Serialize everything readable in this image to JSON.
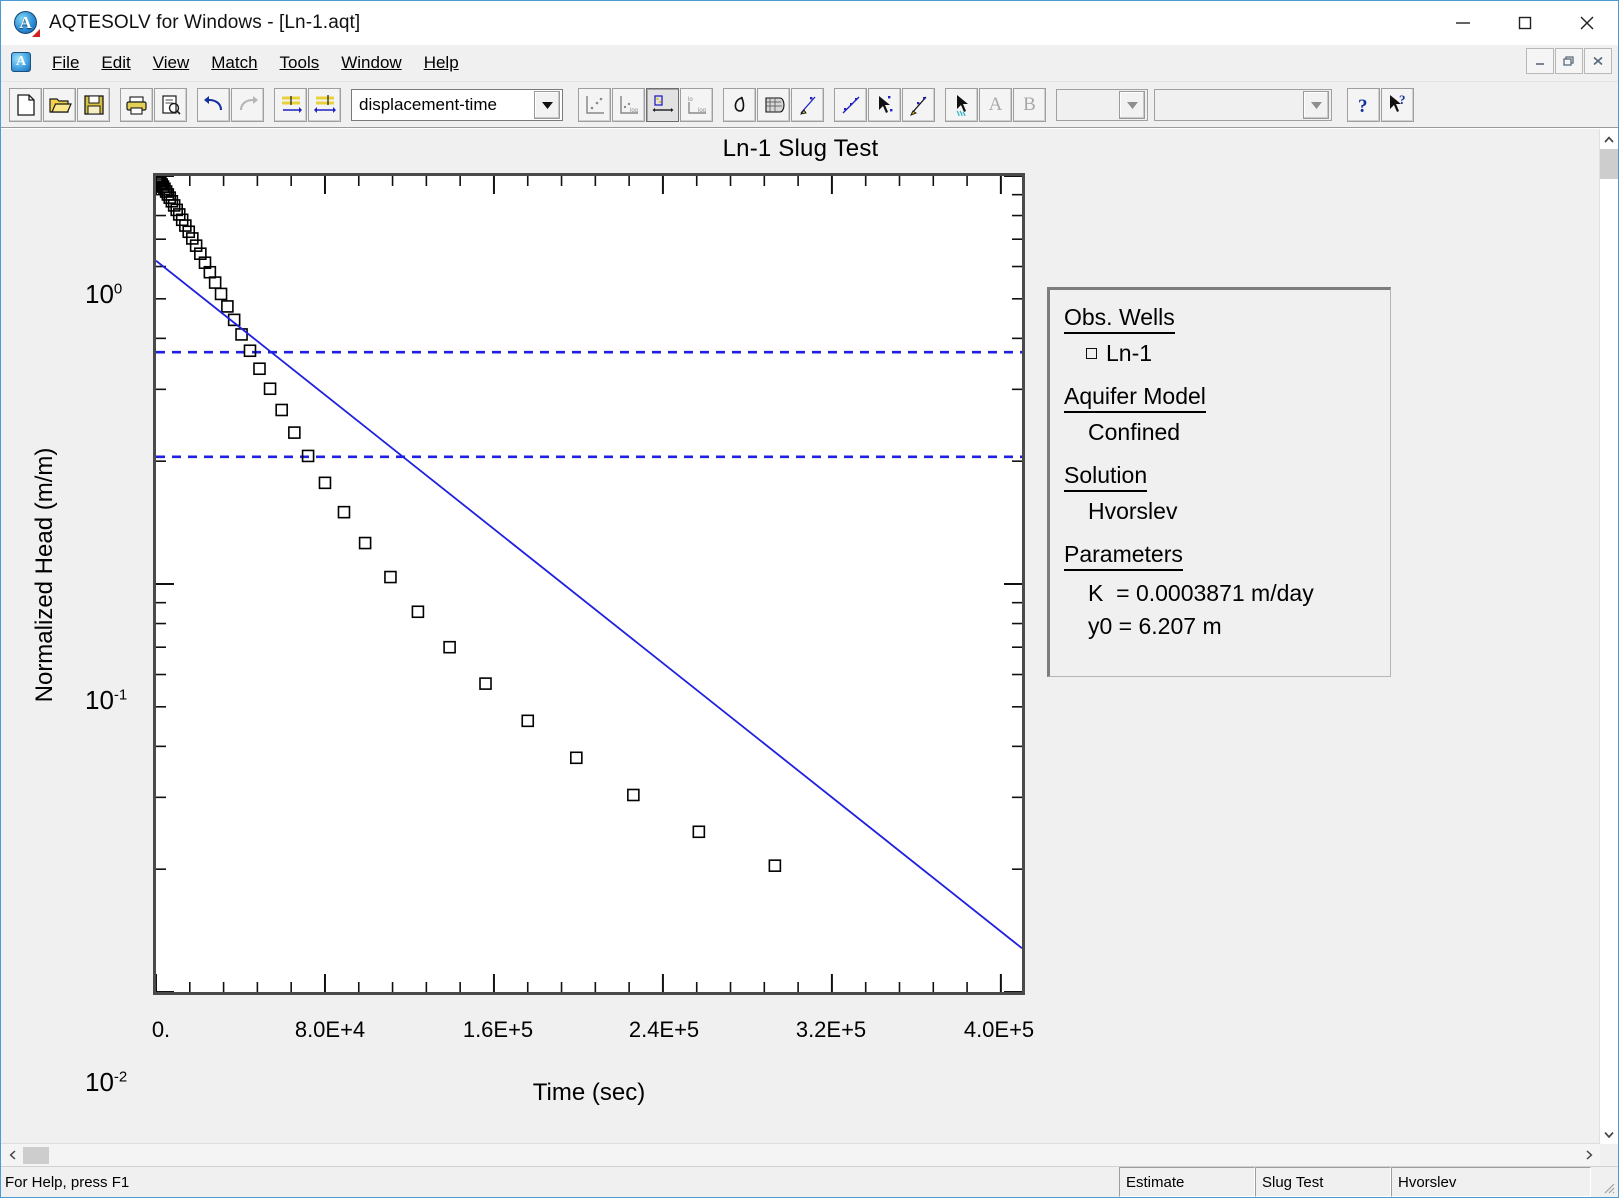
{
  "window": {
    "title": "AQTESOLV for Windows - [Ln-1.aqt]",
    "minimize_label": "Minimize",
    "maximize_label": "Maximize",
    "close_label": "Close"
  },
  "menu": {
    "items": [
      {
        "label": "File",
        "accel": "F"
      },
      {
        "label": "Edit",
        "accel": "E"
      },
      {
        "label": "View",
        "accel": "V"
      },
      {
        "label": "Match",
        "accel": "M"
      },
      {
        "label": "Tools",
        "accel": "T"
      },
      {
        "label": "Window",
        "accel": "W"
      },
      {
        "label": "Help",
        "accel": "H"
      }
    ],
    "mdi_restore_label": "Restore",
    "mdi_minimize_label": "Minimize",
    "mdi_close_label": "Close"
  },
  "toolbar": {
    "plot_type_value": "displacement-time",
    "combo2_value": "",
    "combo3_value": "",
    "buttons": [
      "new-icon",
      "open-icon",
      "save-icon",
      "print-icon",
      "print-preview-icon",
      "undo-icon",
      "redo-icon",
      "well-data-icon",
      "aquifer-data-icon",
      "linear-axes-icon",
      "semilog-axes-icon",
      "log-linear-axes-icon",
      "log-log-axes-icon",
      "derivative-icon",
      "grid-icon",
      "visual-match-icon",
      "auto-fit-icon",
      "select-point-icon",
      "match-line-icon",
      "pointer-icon",
      "text-a-icon",
      "text-b-icon"
    ],
    "letter_a": "A",
    "letter_b": "B",
    "help_label": "?",
    "context_help_label": "?"
  },
  "legend": {
    "sections": [
      {
        "heading": "Obs. Wells",
        "items": [
          {
            "marker": "square-marker",
            "text": "Ln-1"
          }
        ]
      },
      {
        "heading": "Aquifer Model",
        "items": [
          {
            "marker": "",
            "text": "Confined"
          }
        ]
      },
      {
        "heading": "Solution",
        "items": [
          {
            "marker": "",
            "text": "Hvorslev"
          }
        ]
      }
    ],
    "parameters_heading": "Parameters",
    "parameters": [
      "K  = 0.0003871 m/day",
      "y0 = 6.207 m"
    ]
  },
  "status": {
    "help_text": "For Help, press F1",
    "panes": [
      "Estimate",
      "Slug Test",
      "Hvorslev"
    ]
  },
  "chart_data": {
    "type": "scatter",
    "title": "Ln-1 Slug Test",
    "xlabel": "Time (sec)",
    "ylabel": "Normalized Head (m/m)",
    "xscale": "linear",
    "yscale": "log",
    "xlim": [
      0,
      410000
    ],
    "ylim": [
      0.01,
      1.0
    ],
    "grid": false,
    "legend_position": "right-outside",
    "xticks": [
      {
        "value": 0,
        "label": "0."
      },
      {
        "value": 80000,
        "label": "8.0E+4"
      },
      {
        "value": 160000,
        "label": "1.6E+5"
      },
      {
        "value": 240000,
        "label": "2.4E+5"
      },
      {
        "value": 320000,
        "label": "3.2E+5"
      },
      {
        "value": 400000,
        "label": "4.0E+5"
      }
    ],
    "yticks": [
      {
        "value": 1.0,
        "mantissa": "10",
        "exponent": "0"
      },
      {
        "value": 0.1,
        "mantissa": "10",
        "exponent": "-1"
      },
      {
        "value": 0.01,
        "mantissa": "10",
        "exponent": "-2"
      }
    ],
    "series": [
      {
        "name": "Ln-1",
        "type": "scatter",
        "marker": "open-square",
        "color": "#000000",
        "points": [
          [
            300,
            0.995
          ],
          [
            700,
            0.988
          ],
          [
            1100,
            0.98
          ],
          [
            1600,
            0.972
          ],
          [
            2100,
            0.963
          ],
          [
            2700,
            0.953
          ],
          [
            3300,
            0.942
          ],
          [
            4000,
            0.93
          ],
          [
            4800,
            0.916
          ],
          [
            5600,
            0.901
          ],
          [
            6500,
            0.885
          ],
          [
            7500,
            0.867
          ],
          [
            8600,
            0.847
          ],
          [
            9800,
            0.826
          ],
          [
            11000,
            0.805
          ],
          [
            12400,
            0.781
          ],
          [
            13900,
            0.756
          ],
          [
            15500,
            0.73
          ],
          [
            17200,
            0.703
          ],
          [
            19000,
            0.675
          ],
          [
            21000,
            0.645
          ],
          [
            23200,
            0.613
          ],
          [
            25500,
            0.581
          ],
          [
            28000,
            0.548
          ],
          [
            30800,
            0.514
          ],
          [
            33800,
            0.479
          ],
          [
            37000,
            0.444
          ],
          [
            40500,
            0.409
          ],
          [
            44500,
            0.373
          ],
          [
            49000,
            0.337
          ],
          [
            54000,
            0.301
          ],
          [
            59500,
            0.267
          ],
          [
            65500,
            0.235
          ],
          [
            72000,
            0.206
          ],
          [
            80000,
            0.177
          ],
          [
            89000,
            0.15
          ],
          [
            99000,
            0.126
          ],
          [
            111000,
            0.104
          ],
          [
            124000,
            0.0855
          ],
          [
            139000,
            0.07
          ],
          [
            156000,
            0.057
          ],
          [
            176000,
            0.0462
          ],
          [
            199000,
            0.0375
          ],
          [
            226000,
            0.0304
          ],
          [
            257000,
            0.0247
          ],
          [
            293000,
            0.0204
          ]
        ]
      },
      {
        "name": "Hvorslev fit",
        "type": "line",
        "style": "solid",
        "color": "#2020e0",
        "points": [
          [
            0,
            0.62
          ],
          [
            410000,
            0.0128
          ]
        ]
      }
    ],
    "reference_lines": [
      {
        "orientation": "horizontal",
        "value": 0.37,
        "style": "dashed",
        "color": "#2020e0"
      },
      {
        "orientation": "horizontal",
        "value": 0.205,
        "style": "dashed",
        "color": "#2020e0"
      }
    ],
    "annotations": []
  }
}
